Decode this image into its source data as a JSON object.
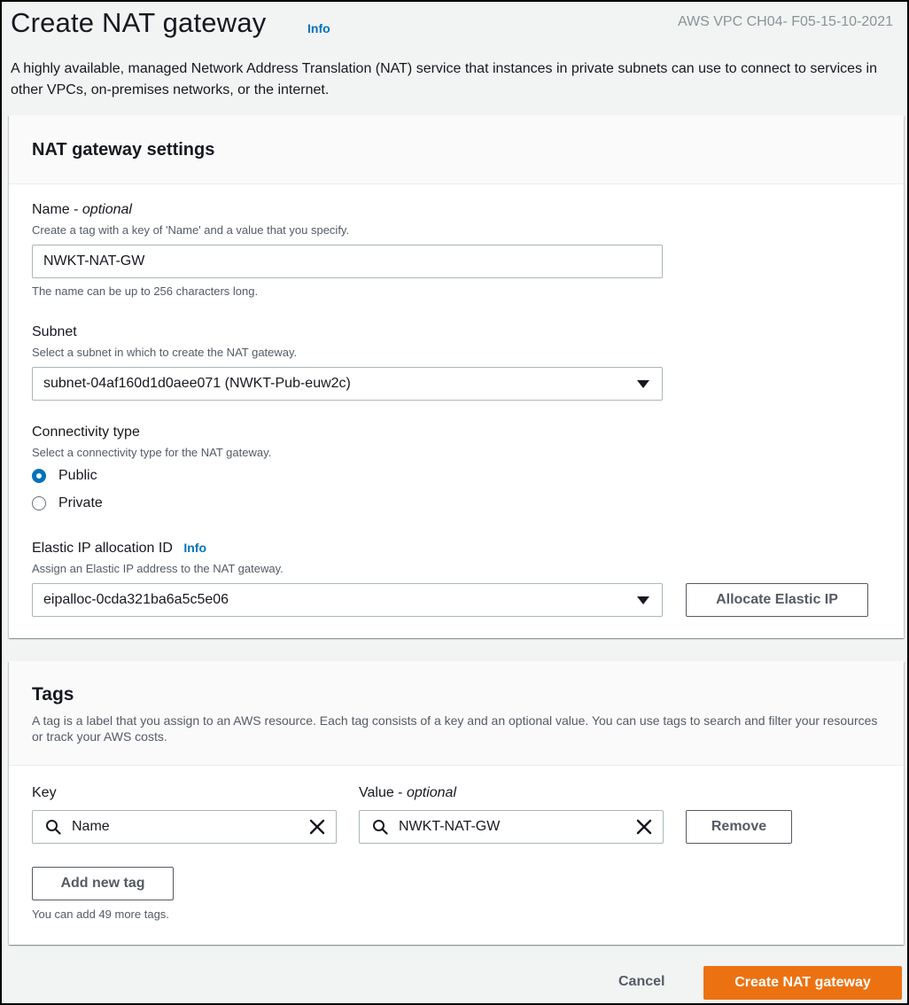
{
  "page": {
    "title": "Create NAT gateway",
    "info_label": "Info",
    "watermark": "AWS VPC CH04- F05-15-10-2021",
    "description": "A highly available, managed Network Address Translation (NAT) service that instances in private subnets can use to connect to services in other VPCs, on-premises networks, or the internet."
  },
  "settings": {
    "title": "NAT gateway settings",
    "name": {
      "label": "Name - ",
      "label_optional": "optional",
      "hint": "Create a tag with a key of 'Name' and a value that you specify.",
      "value": "NWKT-NAT-GW",
      "constraint": "The name can be up to 256 characters long."
    },
    "subnet": {
      "label": "Subnet",
      "hint": "Select a subnet in which to create the NAT gateway.",
      "value": "subnet-04af160d1d0aee071 (NWKT-Pub-euw2c)"
    },
    "connectivity": {
      "label": "Connectivity type",
      "hint": "Select a connectivity type for the NAT gateway.",
      "options": [
        {
          "label": "Public",
          "checked": true
        },
        {
          "label": "Private",
          "checked": false
        }
      ]
    },
    "eip": {
      "label": "Elastic IP allocation ID",
      "info_label": "Info",
      "hint": "Assign an Elastic IP address to the NAT gateway.",
      "value": "eipalloc-0cda321ba6a5c5e06",
      "allocate_button": "Allocate Elastic IP"
    }
  },
  "tags": {
    "title": "Tags",
    "description": "A tag is a label that you assign to an AWS resource. Each tag consists of a key and an optional value. You can use tags to search and filter your resources or track your AWS costs.",
    "key_label": "Key",
    "value_label": "Value - ",
    "value_label_optional": "optional",
    "rows": [
      {
        "key": "Name",
        "value": "NWKT-NAT-GW",
        "remove_label": "Remove"
      }
    ],
    "add_button": "Add new tag",
    "remaining_hint": "You can add 49 more tags."
  },
  "footer": {
    "cancel_label": "Cancel",
    "create_label": "Create NAT gateway"
  },
  "colors": {
    "primary": "#ec7211",
    "link": "#0073bb"
  }
}
